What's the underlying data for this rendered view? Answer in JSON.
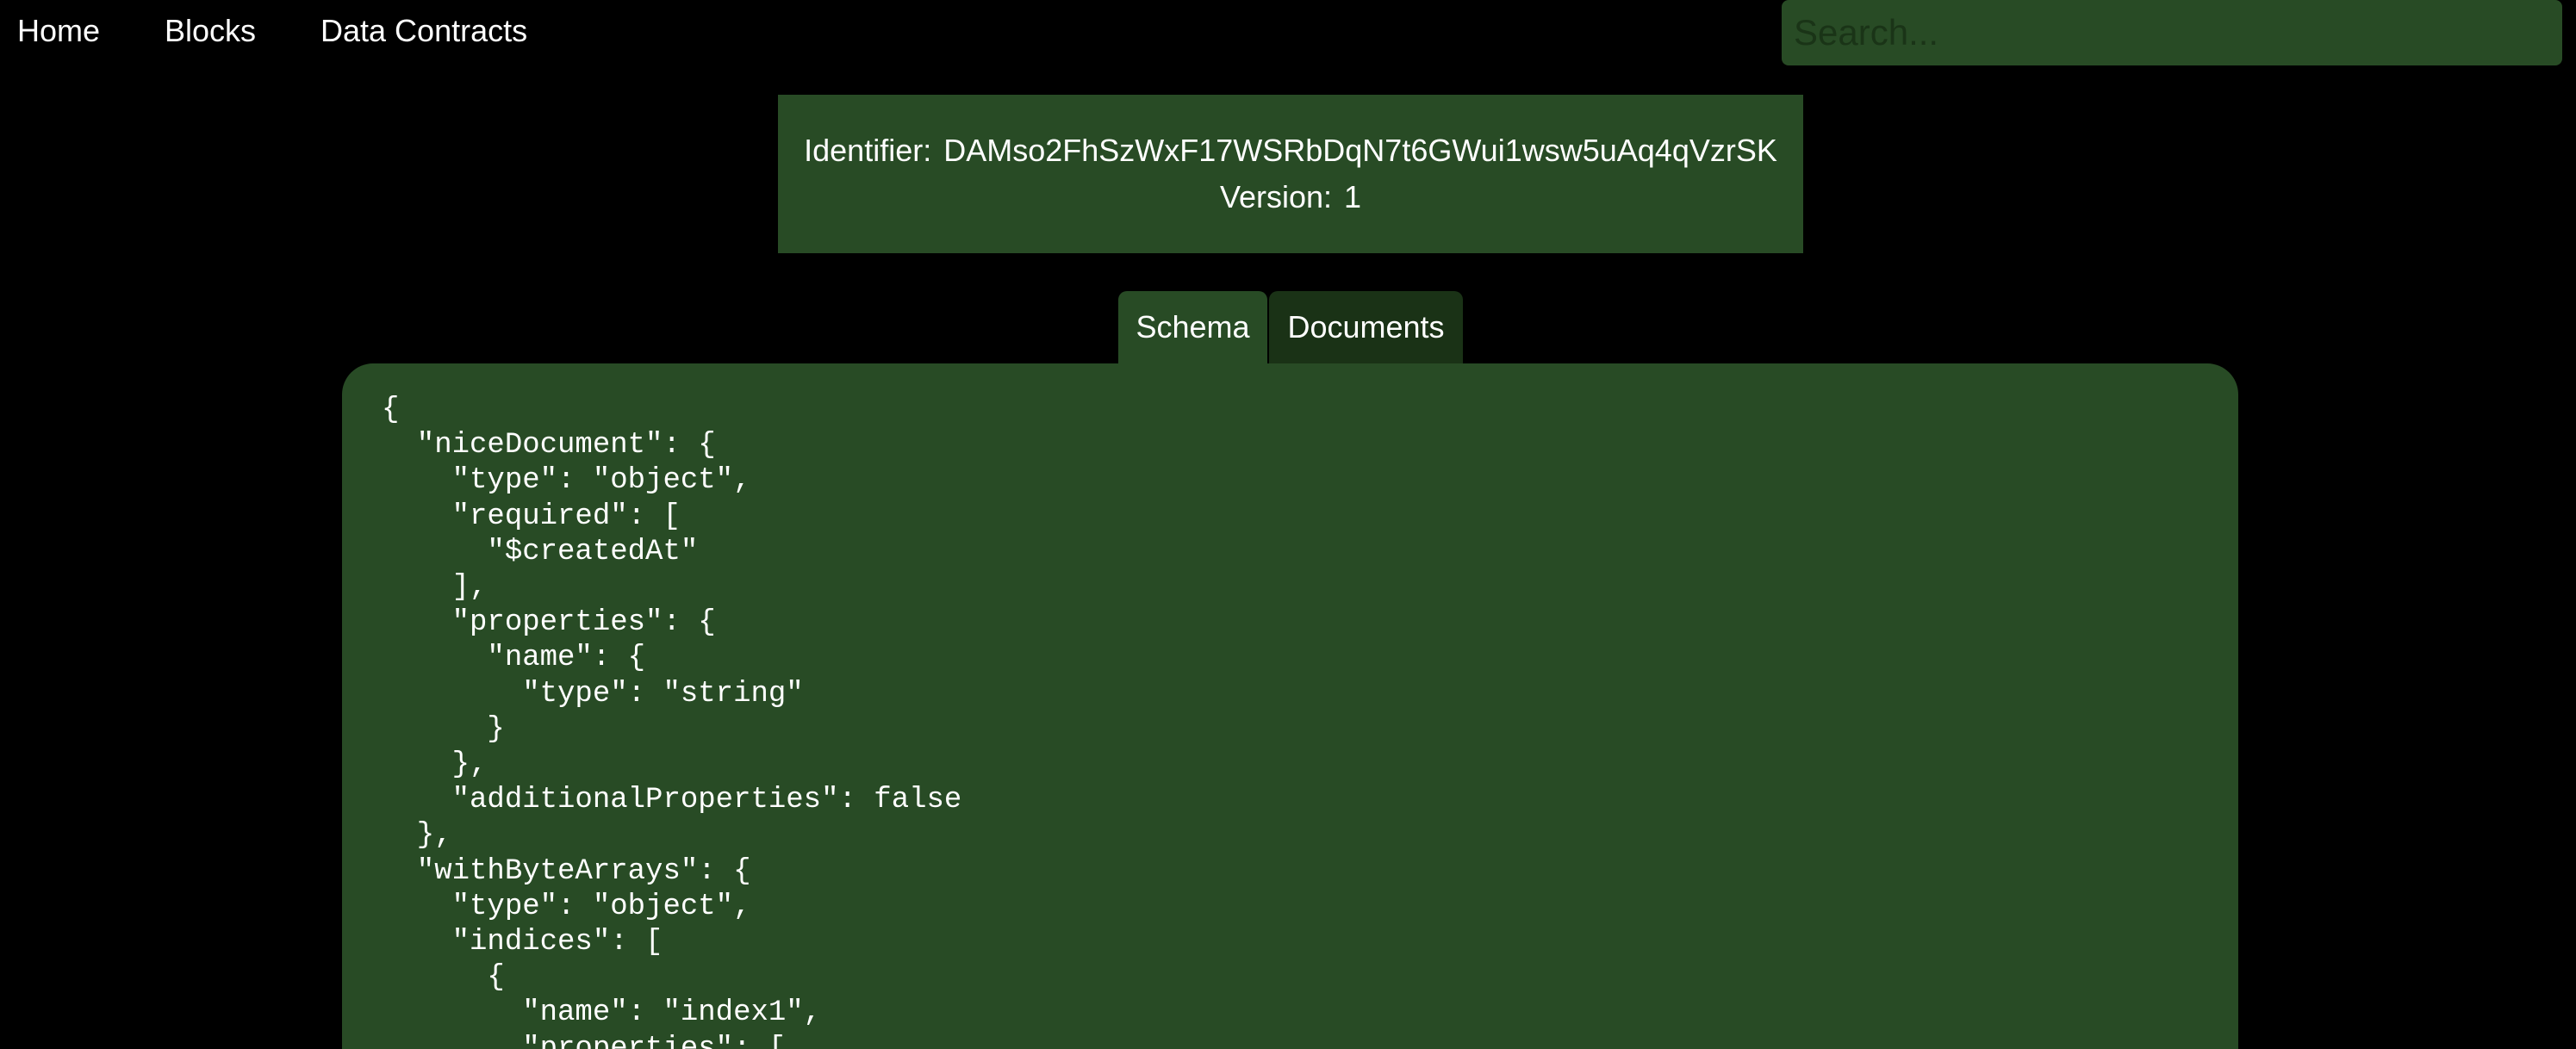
{
  "nav": {
    "home": "Home",
    "blocks": "Blocks",
    "data_contracts": "Data Contracts"
  },
  "search": {
    "placeholder": "Search..."
  },
  "contract": {
    "identifier_label": "Identifier:",
    "identifier_value": "DAMso2FhSzWxF17WSRbDqN7t6GWui1wsw5uAq4qVzrSK",
    "version_label": "Version:",
    "version_value": "1"
  },
  "tabs": {
    "schema": "Schema",
    "documents": "Documents"
  },
  "schema_lines": [
    "{",
    "  \"niceDocument\": {",
    "    \"type\": \"object\",",
    "    \"required\": [",
    "      \"$createdAt\"",
    "    ],",
    "    \"properties\": {",
    "      \"name\": {",
    "        \"type\": \"string\"",
    "      }",
    "    },",
    "    \"additionalProperties\": false",
    "  },",
    "  \"withByteArrays\": {",
    "    \"type\": \"object\",",
    "    \"indices\": [",
    "      {",
    "        \"name\": \"index1\",",
    "        \"properties\": ["
  ],
  "colors": {
    "background": "#000000",
    "panel": "#284b25",
    "tab_inactive": "#1a3216",
    "text": "#ffffff"
  }
}
